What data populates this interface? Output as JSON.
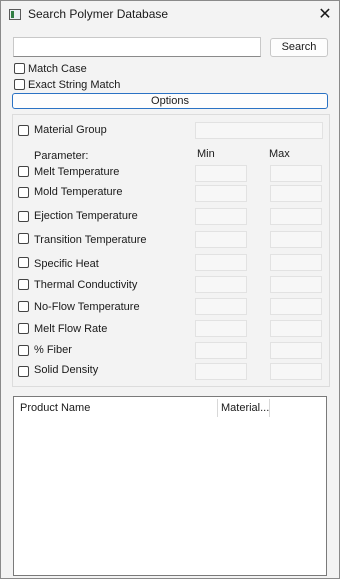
{
  "window": {
    "title": "Search Polymer Database",
    "close_glyph": "✕",
    "icon": "database-window-icon"
  },
  "search": {
    "value": "",
    "placeholder": "",
    "button_label": "Search"
  },
  "checks": {
    "match_case": "Match Case",
    "exact_string": "Exact String Match"
  },
  "options_label": "Options",
  "filters": {
    "material_group": "Material Group",
    "parameter_header": "Parameter:",
    "min_header": "Min",
    "max_header": "Max",
    "params": [
      "Melt Temperature",
      "Mold Temperature",
      "Ejection Temperature",
      "Transition Temperature",
      "Specific Heat",
      "Thermal Conductivity",
      "No-Flow Temperature",
      "Melt Flow Rate",
      "% Fiber",
      "Solid Density"
    ]
  },
  "results": {
    "columns": [
      "Product Name",
      "Material..."
    ]
  }
}
